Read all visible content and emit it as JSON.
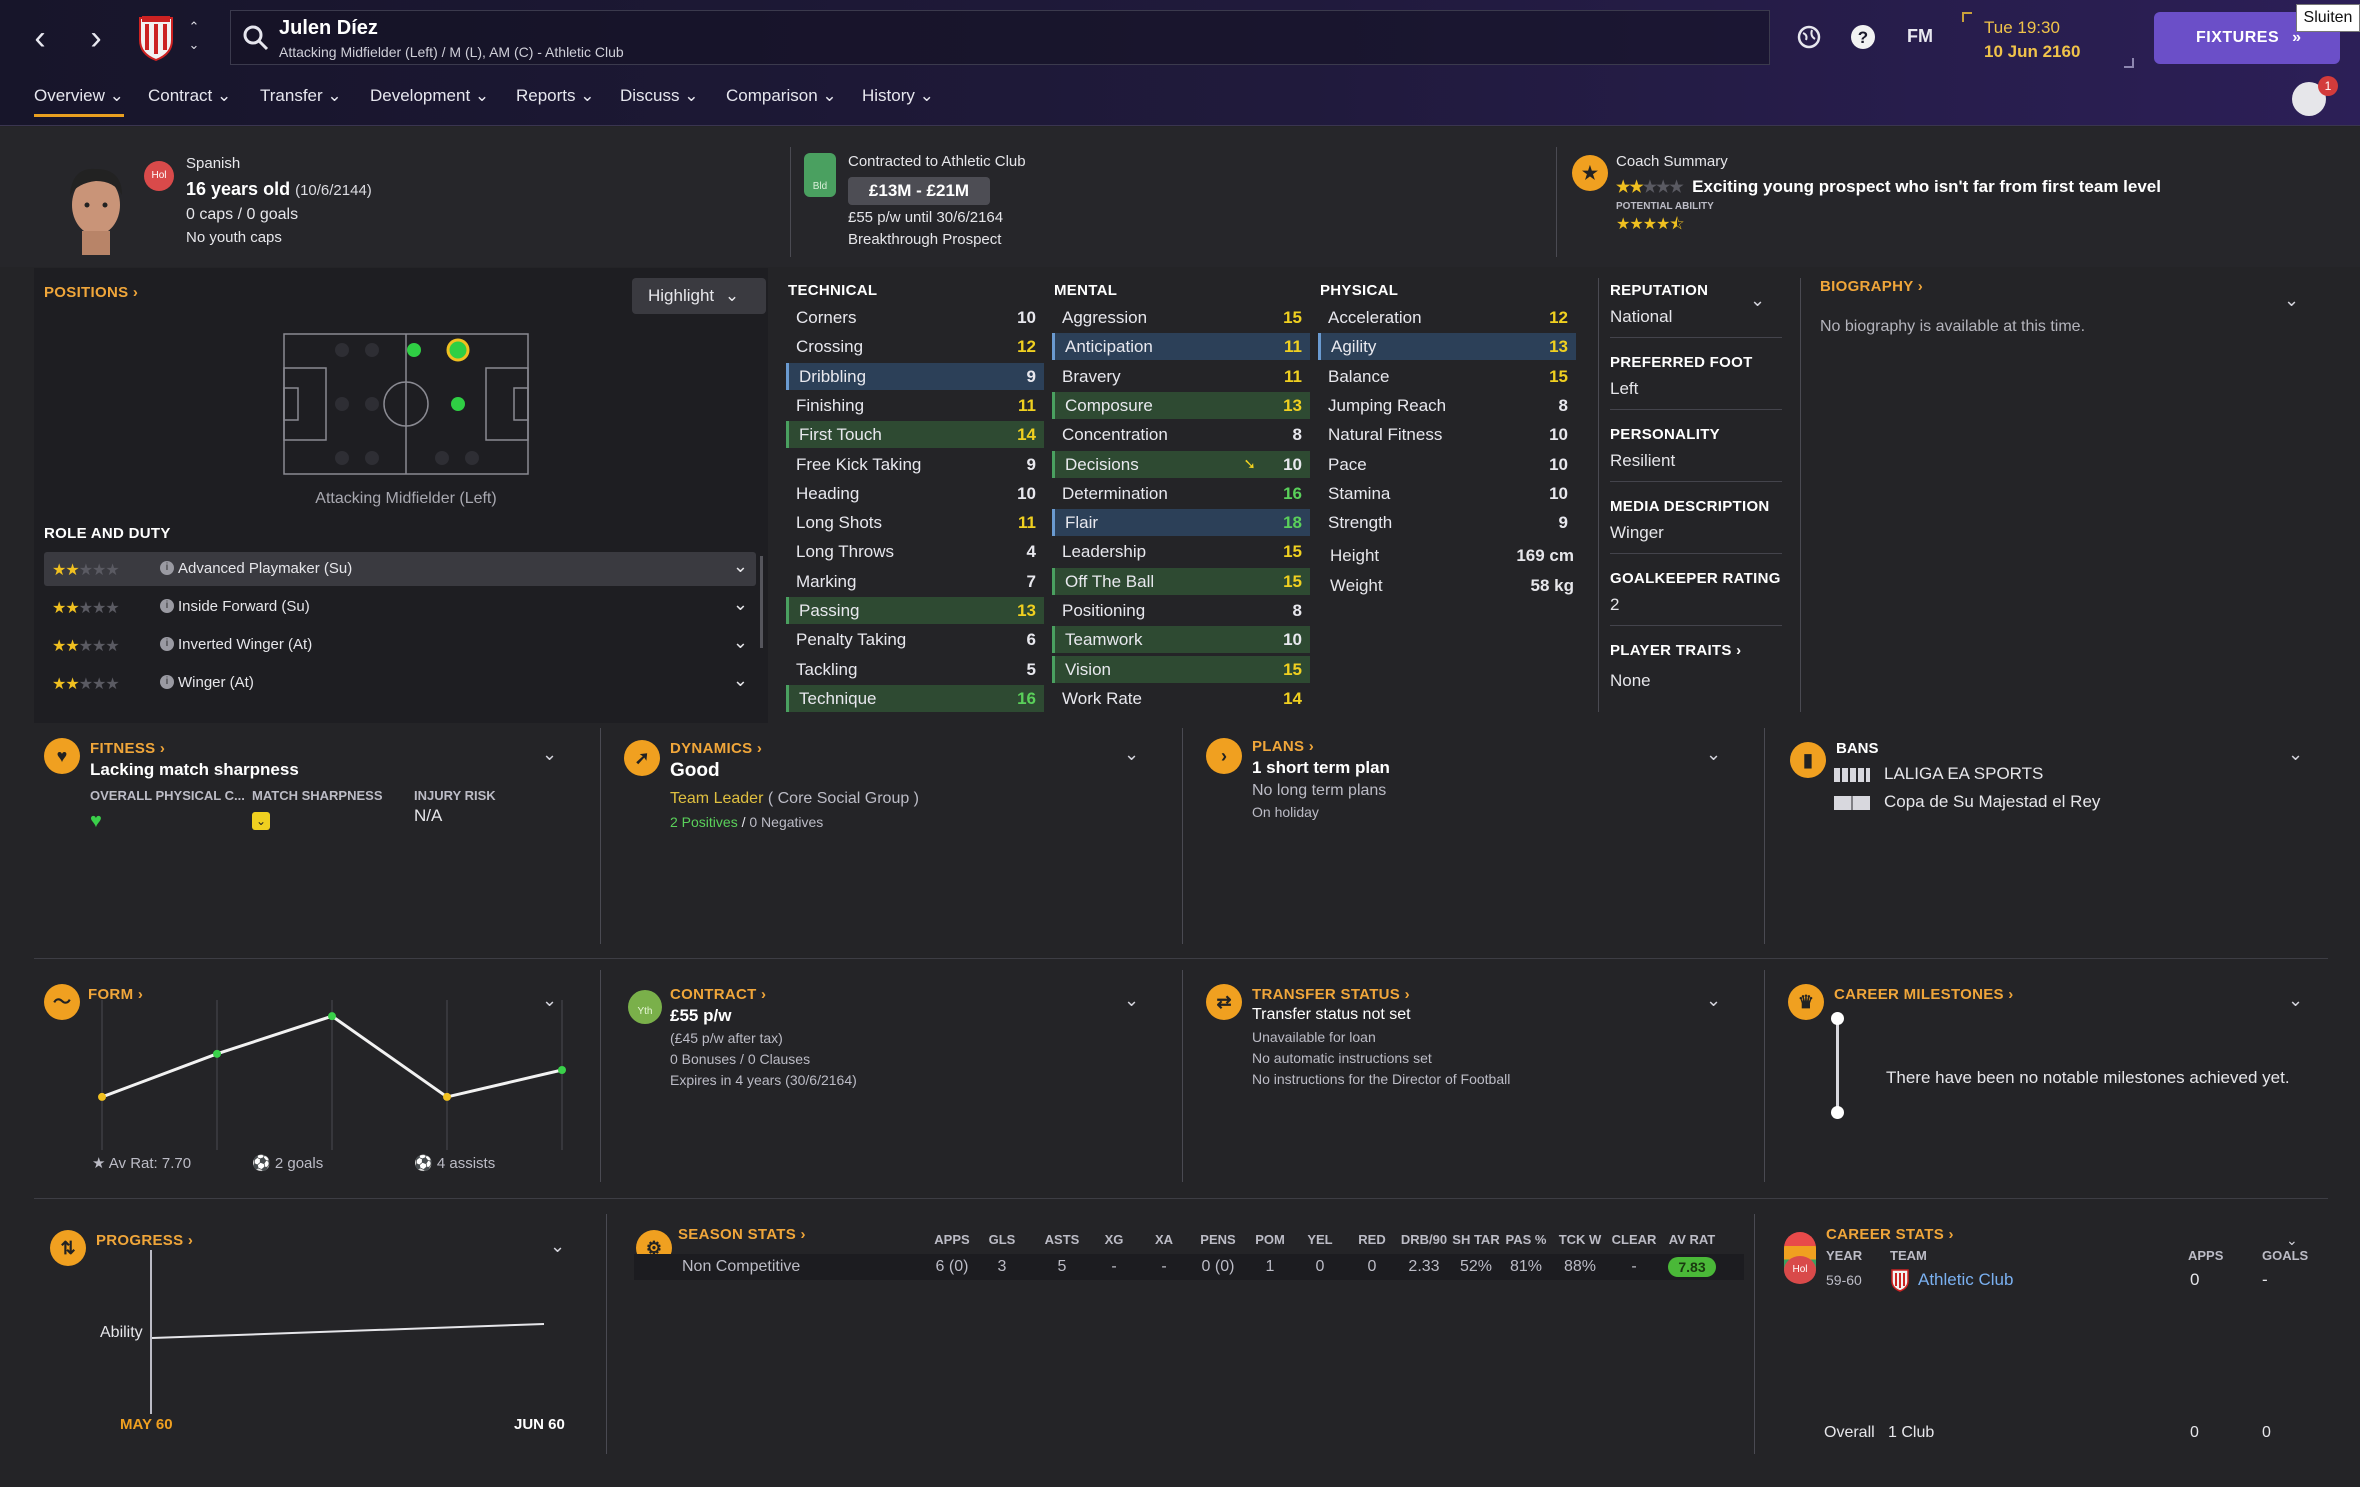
{
  "header": {
    "player_name": "Julen Díez",
    "player_subtitle": "Attacking Midfielder (Left) / M (L), AM (C) - Athletic Club",
    "game_short": "FM",
    "time": "Tue 19:30",
    "date": "10 Jun 2160",
    "fixtures_label": "FIXTURES",
    "tooltip": "Sluiten",
    "notification_count": "1"
  },
  "tabs": [
    "Overview",
    "Contract",
    "Transfer",
    "Development",
    "Reports",
    "Discuss",
    "Comparison",
    "History"
  ],
  "profile": {
    "nation_badge": "Hol",
    "nationality": "Spanish",
    "age": "16 years old",
    "dob": "(10/6/2144)",
    "caps": "0 caps / 0 goals",
    "youth_caps": "No youth caps",
    "contract_badge": "Bld",
    "contracted_to": "Contracted to Athletic Club",
    "value_range": "£13M - £21M",
    "wage": "£55 p/w until 30/6/2164",
    "status": "Breakthrough Prospect",
    "coach_summary_label": "Coach Summary",
    "coach_summary": "Exciting young prospect who isn't far from first team level",
    "potential_label": "POTENTIAL ABILITY",
    "current_stars": 2,
    "potential_stars": 4.5
  },
  "positions": {
    "title": "POSITIONS",
    "highlight_label": "Highlight",
    "position_name": "Attacking Midfielder (Left)",
    "role_title": "ROLE AND DUTY",
    "roles": [
      {
        "name": "Advanced Playmaker (Su)",
        "stars": 2
      },
      {
        "name": "Inside Forward (Su)",
        "stars": 2
      },
      {
        "name": "Inverted Winger (At)",
        "stars": 2
      },
      {
        "name": "Winger (At)",
        "stars": 2
      }
    ]
  },
  "technical": {
    "title": "TECHNICAL",
    "rows": [
      {
        "name": "Corners",
        "value": "10"
      },
      {
        "name": "Crossing",
        "value": "12"
      },
      {
        "name": "Dribbling",
        "value": "9"
      },
      {
        "name": "Finishing",
        "value": "11"
      },
      {
        "name": "First Touch",
        "value": "14"
      },
      {
        "name": "Free Kick Taking",
        "value": "9"
      },
      {
        "name": "Heading",
        "value": "10"
      },
      {
        "name": "Long Shots",
        "value": "11"
      },
      {
        "name": "Long Throws",
        "value": "4"
      },
      {
        "name": "Marking",
        "value": "7"
      },
      {
        "name": "Passing",
        "value": "13"
      },
      {
        "name": "Penalty Taking",
        "value": "6"
      },
      {
        "name": "Tackling",
        "value": "5"
      },
      {
        "name": "Technique",
        "value": "16"
      }
    ]
  },
  "mental": {
    "title": "MENTAL",
    "rows": [
      {
        "name": "Aggression",
        "value": "15"
      },
      {
        "name": "Anticipation",
        "value": "11"
      },
      {
        "name": "Bravery",
        "value": "11"
      },
      {
        "name": "Composure",
        "value": "13"
      },
      {
        "name": "Concentration",
        "value": "8"
      },
      {
        "name": "Decisions",
        "value": "10"
      },
      {
        "name": "Determination",
        "value": "16"
      },
      {
        "name": "Flair",
        "value": "18"
      },
      {
        "name": "Leadership",
        "value": "15"
      },
      {
        "name": "Off The Ball",
        "value": "15"
      },
      {
        "name": "Positioning",
        "value": "8"
      },
      {
        "name": "Teamwork",
        "value": "10"
      },
      {
        "name": "Vision",
        "value": "15"
      },
      {
        "name": "Work Rate",
        "value": "14"
      }
    ]
  },
  "physical": {
    "title": "PHYSICAL",
    "rows": [
      {
        "name": "Acceleration",
        "value": "12"
      },
      {
        "name": "Agility",
        "value": "13"
      },
      {
        "name": "Balance",
        "value": "15"
      },
      {
        "name": "Jumping Reach",
        "value": "8"
      },
      {
        "name": "Natural Fitness",
        "value": "10"
      },
      {
        "name": "Pace",
        "value": "10"
      },
      {
        "name": "Stamina",
        "value": "10"
      },
      {
        "name": "Strength",
        "value": "9"
      }
    ],
    "height_label": "Height",
    "height": "169 cm",
    "weight_label": "Weight",
    "weight": "58 kg"
  },
  "info": {
    "reputation_label": "REPUTATION",
    "reputation": "National",
    "foot_label": "PREFERRED FOOT",
    "foot": "Left",
    "personality_label": "PERSONALITY",
    "personality": "Resilient",
    "media_label": "MEDIA DESCRIPTION",
    "media": "Winger",
    "gk_label": "GOALKEEPER RATING",
    "gk": "2",
    "traits_label": "PLAYER TRAITS",
    "traits": "None",
    "bio_label": "BIOGRAPHY",
    "bio": "No biography is available at this time."
  },
  "fitness": {
    "title": "FITNESS",
    "status": "Lacking match sharpness",
    "col1": "OVERALL PHYSICAL C...",
    "col2": "MATCH SHARPNESS",
    "col3": "INJURY RISK",
    "injury": "N/A"
  },
  "dynamics": {
    "title": "DYNAMICS",
    "status": "Good",
    "role": "Team Leader",
    "group": "( Core Social Group )",
    "positives": "2 Positives",
    "sep": "/",
    "negatives": "0 Negatives"
  },
  "plans": {
    "title": "PLANS",
    "line1": "1 short term plan",
    "line2": "No long term plans",
    "line3": "On holiday"
  },
  "bans": {
    "title": "BANS",
    "comp1": "LALIGA EA SPORTS",
    "comp2": "Copa de Su Majestad el Rey"
  },
  "form": {
    "title": "FORM",
    "avrat": "Av Rat: 7.70",
    "goals": "2 goals",
    "assists": "4 assists",
    "ratings": [
      6.8,
      7.6,
      8.3,
      6.8,
      7.3
    ]
  },
  "contract": {
    "title": "CONTRACT",
    "badge": "Yth",
    "wage": "£55 p/w",
    "after_tax": "(£45 p/w after tax)",
    "bonuses": "0 Bonuses / 0 Clauses",
    "expires": "Expires in 4 years (30/6/2164)"
  },
  "transfer": {
    "title": "TRANSFER STATUS",
    "status": "Transfer status not set",
    "loan": "Unavailable for loan",
    "auto": "No automatic instructions set",
    "dof": "No instructions for the Director of Football"
  },
  "milestones": {
    "title": "CAREER MILESTONES",
    "text": "There have been no notable milestones achieved yet."
  },
  "progress": {
    "title": "PROGRESS",
    "ability_label": "Ability",
    "start": "MAY 60",
    "end": "JUN 60"
  },
  "season": {
    "title": "SEASON STATS",
    "headers": [
      "APPS",
      "GLS",
      "ASTS",
      "XG",
      "XA",
      "PENS",
      "POM",
      "YEL",
      "RED",
      "DRB/90",
      "SH TAR",
      "PAS %",
      "TCK W",
      "CLEAR",
      "AV RAT"
    ],
    "row_label": "Non Competitive",
    "values": [
      "6 (0)",
      "3",
      "5",
      "-",
      "-",
      "0 (0)",
      "1",
      "0",
      "0",
      "2.33",
      "52%",
      "81%",
      "88%",
      "-",
      "7.83"
    ]
  },
  "career": {
    "title": "CAREER STATS",
    "badge": "Hol",
    "year_h": "YEAR",
    "team_h": "TEAM",
    "apps_h": "APPS",
    "goals_h": "GOALS",
    "year": "59-60",
    "team": "Athletic Club",
    "apps": "0",
    "goals": "-",
    "overall": "Overall",
    "clubs": "1 Club",
    "total_apps": "0",
    "total_goals": "0"
  },
  "colors": {
    "accent": "#f0a020",
    "green_text": "#5ad05a",
    "yellow_text": "#f0d020",
    "fixtures": "#6b4fc8"
  }
}
